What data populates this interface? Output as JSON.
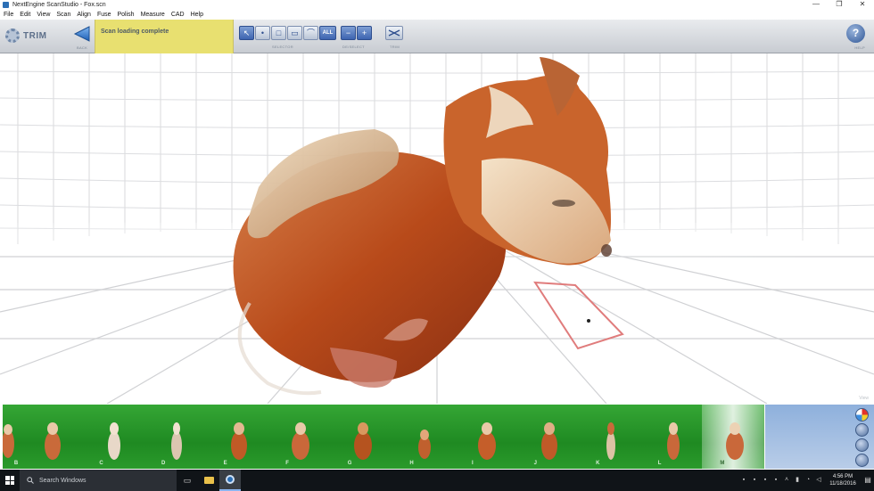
{
  "window": {
    "title": "NextEngine ScanStudio - Fox.scn",
    "minimize": "—",
    "restore": "❐",
    "close": "✕"
  },
  "menu": [
    "File",
    "Edit",
    "View",
    "Scan",
    "Align",
    "Fuse",
    "Polish",
    "Measure",
    "CAD",
    "Help"
  ],
  "toolbar": {
    "mode_label": "TRIM",
    "back_caption": "BACK",
    "status_message": "Scan loading complete",
    "selector_caption": "SELECTOR",
    "selector_tools": [
      "arrow",
      "dot",
      "rect",
      "square",
      "lasso"
    ],
    "selector_all_label": "ALL",
    "deselect_caption": "DE/SELECT",
    "deselect_minus": "−",
    "deselect_plus": "+",
    "trim_caption": "TRIM",
    "help_label": "?",
    "help_caption": "HELP",
    "selector_icons": {
      "arrow": "↖",
      "dot": "•",
      "rect": "□",
      "square": "▭",
      "lasso": "⌒"
    }
  },
  "viewport": {
    "view_label": "View",
    "colors": {
      "grid": "#d9dadc",
      "fox_orange": "#c05a22",
      "fox_cream": "#ecd6b4",
      "selection_box": "#e07070"
    }
  },
  "thumbnails": {
    "items": [
      {
        "tag": "B"
      },
      {
        "tag": "C"
      },
      {
        "tag": "D"
      },
      {
        "tag": "E"
      },
      {
        "tag": "F"
      },
      {
        "tag": "G"
      },
      {
        "tag": "H"
      },
      {
        "tag": "I"
      },
      {
        "tag": "J"
      },
      {
        "tag": "K"
      },
      {
        "tag": "L"
      },
      {
        "tag": "M"
      }
    ],
    "selected": "M",
    "strip_color": "#2a9a2b"
  },
  "taskbar": {
    "search_placeholder": "Search Windows",
    "time": "4:56 PM",
    "date": "11/18/2016"
  }
}
